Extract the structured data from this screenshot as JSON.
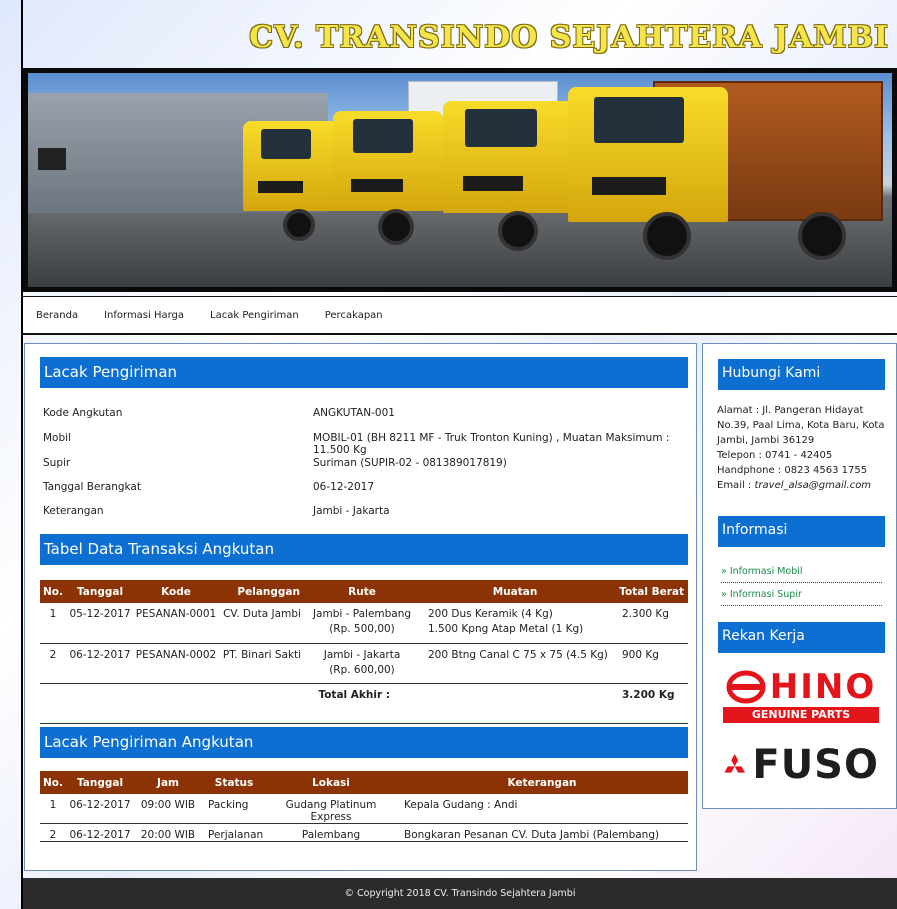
{
  "header": {
    "site_title": "CV. TRANSINDO SEJAHTERA JAMBI"
  },
  "nav": {
    "items": [
      "Beranda",
      "Informasi Harga",
      "Lacak Pengiriman",
      "Percakapan"
    ]
  },
  "lacak": {
    "title": "Lacak Pengiriman",
    "fields": [
      {
        "label": "Kode Angkutan",
        "value": "ANGKUTAN-001"
      },
      {
        "label": "Mobil",
        "value": "MOBIL-01 (BH 8211 MF - Truk Tronton Kuning) , Muatan Maksimum : 11.500 Kg"
      },
      {
        "label": "Supir",
        "value": "Suriman (SUPIR-02 - 081389017819)"
      },
      {
        "label": "Tanggal Berangkat",
        "value": "06-12-2017"
      },
      {
        "label": "Keterangan",
        "value": "Jambi - Jakarta"
      }
    ]
  },
  "transaksi": {
    "title": "Tabel Data Transaksi Angkutan",
    "columns": [
      "No.",
      "Tanggal",
      "Kode",
      "Pelanggan",
      "Rute",
      "Muatan",
      "Total Berat"
    ],
    "rows": [
      {
        "no": "1",
        "tanggal": "05-12-2017",
        "kode": "PESANAN-0001",
        "pelanggan": "CV. Duta Jambi",
        "rute1": "Jambi - Palembang",
        "rute2": "(Rp. 500,00)",
        "muatan1": "200 Dus Keramik (4 Kg)",
        "muatan2": "1.500 Kpng Atap Metal (1 Kg)",
        "berat": "2.300 Kg"
      },
      {
        "no": "2",
        "tanggal": "06-12-2017",
        "kode": "PESANAN-0002",
        "pelanggan": "PT. Binari Sakti",
        "rute1": "Jambi - Jakarta",
        "rute2": "(Rp. 600,00)",
        "muatan1": "200 Btng Canal C 75 x 75 (4.5 Kg)",
        "muatan2": "",
        "berat": "900 Kg"
      }
    ],
    "total_label": "Total Akhir :",
    "total_value": "3.200 Kg"
  },
  "pengiriman": {
    "title": "Lacak Pengiriman Angkutan",
    "columns": [
      "No.",
      "Tanggal",
      "Jam",
      "Status",
      "Lokasi",
      "Keterangan"
    ],
    "rows": [
      {
        "no": "1",
        "tanggal": "06-12-2017",
        "jam": "09:00 WIB",
        "status": "Packing",
        "lokasi": "Gudang Platinum Express",
        "keterangan": "Kepala Gudang : Andi"
      },
      {
        "no": "2",
        "tanggal": "06-12-2017",
        "jam": "20:00 WIB",
        "status": "Perjalanan",
        "lokasi": "Palembang",
        "keterangan": "Bongkaran Pesanan CV. Duta Jambi (Palembang)"
      }
    ]
  },
  "sidebar": {
    "hubungi_title": "Hubungi Kami",
    "alamat": "Alamat : Jl. Pangeran Hidayat No.39, Paal Lima, Kota Baru, Kota Jambi, Jambi 36129",
    "telepon": "Telepon : 0741 - 42405",
    "handphone": "Handphone : 0823 4563 1755",
    "email_label": "Email : ",
    "email": "travel_alsa@gmail.com",
    "informasi_title": "Informasi",
    "links": [
      "» Informasi Mobil",
      "» Informasi Supir"
    ],
    "rekan_title": "Rekan Kerja",
    "hino_logo": "HINO",
    "hino_tag": "GENUINE PARTS",
    "fuso_logo": "FUSO"
  },
  "footer": {
    "copyright": "© Copyright 2018 CV. Transindo Sejahtera Jambi"
  }
}
